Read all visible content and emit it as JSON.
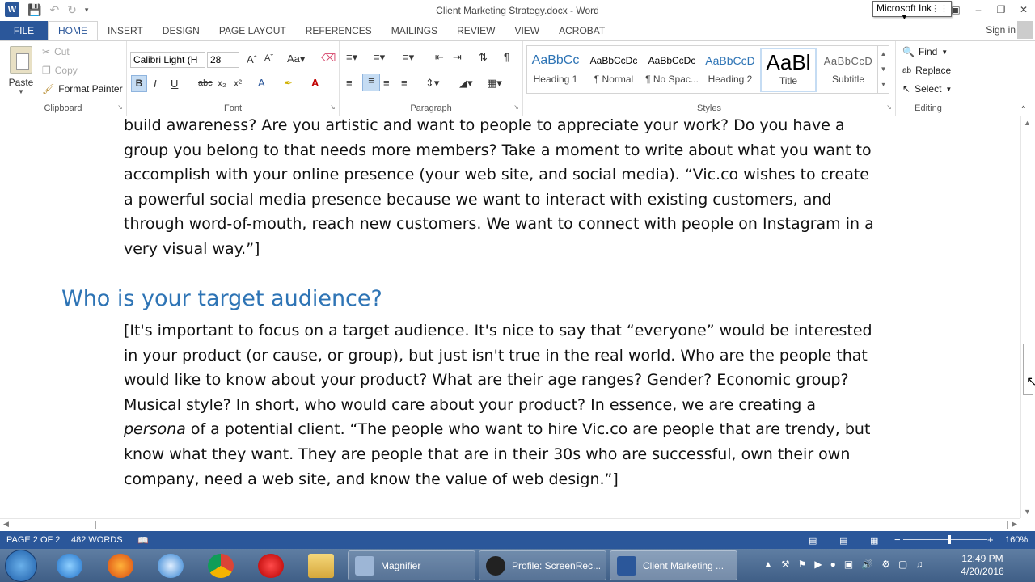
{
  "window": {
    "title": "Client Marketing Strategy.docx - Word",
    "tooltip": "Microsoft Ink"
  },
  "tabs": [
    "FILE",
    "HOME",
    "INSERT",
    "DESIGN",
    "PAGE LAYOUT",
    "REFERENCES",
    "MAILINGS",
    "REVIEW",
    "VIEW",
    "ACROBAT"
  ],
  "signin": "Sign in",
  "clipboard": {
    "paste": "Paste",
    "cut": "Cut",
    "copy": "Copy",
    "format_painter": "Format Painter",
    "label": "Clipboard"
  },
  "font": {
    "family": "Calibri Light (H",
    "size": "28",
    "label": "Font"
  },
  "paragraph": {
    "label": "Paragraph"
  },
  "styles": {
    "label": "Styles",
    "items": [
      {
        "preview": "AaBbCc",
        "name": "Heading 1"
      },
      {
        "preview": "AaBbCcDc",
        "name": "¶ Normal"
      },
      {
        "preview": "AaBbCcDc",
        "name": "¶ No Spac..."
      },
      {
        "preview": "AaBbCcD",
        "name": "Heading 2"
      },
      {
        "preview": "AaBl",
        "name": "Title"
      },
      {
        "preview": "AaBbCcD",
        "name": "Subtitle"
      }
    ]
  },
  "editing": {
    "find": "Find",
    "replace": "Replace",
    "select": "Select",
    "label": "Editing"
  },
  "document": {
    "para1": "build awareness? Are you artistic and want to people to appreciate your work? Do you have a group you belong to that needs more members? Take a moment to write about what you want to accomplish with your online presence (your web site, and social media). “Vic.co wishes to create a powerful social media presence because we want to interact with existing customers, and through word-of-mouth, reach new customers. We want to connect with people on Instagram in a very visual way.”]",
    "heading": "Who is your target audience?",
    "para2_a": "[It's important to focus on a target audience. It's nice to say that “everyone” would be interested in your product (or cause, or group), but just isn't true in the real world. Who are the people that would like to know about your product? What are their age ranges? Gender? Economic group? Musical style? In short, who would care about your product? In essence, we are creating a ",
    "para2_em": "persona",
    "para2_b": " of a potential client. “The people who want to hire Vic.co are people that are trendy, but know what they want. They are people that are in their 30s who are successful, own their own company, need a web site, and know the value of web design.”]"
  },
  "status": {
    "page": "PAGE 2 OF 2",
    "words": "482 WORDS",
    "zoom": "160%"
  },
  "taskbar": {
    "magnifier": "Magnifier",
    "screenrec": "Profile: ScreenRec...",
    "word": "Client Marketing ...",
    "time": "12:49 PM",
    "date": "4/20/2016"
  },
  "colors": {
    "word_blue": "#2b579a",
    "heading_blue": "#2e74b5"
  }
}
